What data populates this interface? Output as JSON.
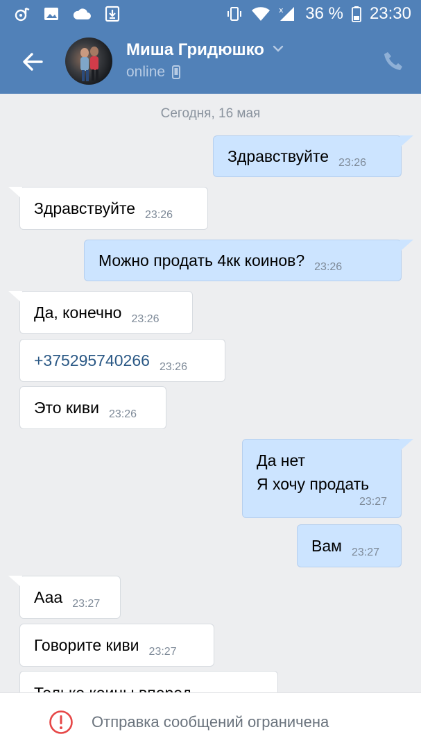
{
  "status_bar": {
    "battery_percent": "36 %",
    "time": "23:30",
    "icons": [
      "music-icon",
      "image-icon",
      "cloud-icon",
      "download-icon",
      "vibrate-icon",
      "wifi-icon",
      "signal-icon",
      "battery-icon"
    ]
  },
  "header": {
    "contact_name": "Миша Гридюшко",
    "presence": "online",
    "icons": [
      "back-arrow-icon",
      "chevron-down-icon",
      "mobile-icon",
      "phone-icon"
    ]
  },
  "chat": {
    "date_separator": "Сегодня, 16 мая",
    "messages": [
      {
        "dir": "out",
        "text": "Здравствуйте",
        "time": "23:26"
      },
      {
        "dir": "in",
        "text": "Здравствуйте",
        "time": "23:26"
      },
      {
        "dir": "out",
        "text": "Можно продать 4кк коинов?",
        "time": "23:26"
      },
      {
        "dir": "in",
        "text": "Да, конечно",
        "time": "23:26"
      },
      {
        "dir": "in",
        "text": "+375295740266",
        "time": "23:26",
        "link": true
      },
      {
        "dir": "in",
        "text": "Это киви",
        "time": "23:26"
      },
      {
        "dir": "out",
        "lines": [
          "Да нет",
          "Я хочу продать"
        ],
        "time": "23:27"
      },
      {
        "dir": "out",
        "text": "Вам",
        "time": "23:27"
      },
      {
        "dir": "in",
        "text": "Ааа",
        "time": "23:27"
      },
      {
        "dir": "in",
        "text": "Говорите киви",
        "time": "23:27"
      },
      {
        "dir": "in",
        "text": "Только коины вперед",
        "time": ""
      }
    ]
  },
  "footer": {
    "restriction_text": "Отправка сообщений ограничена",
    "icon": "alert-circle-icon"
  },
  "colors": {
    "header_bg": "#5181b8",
    "chat_bg": "#edeef0",
    "outgoing_bubble": "#cce4ff",
    "incoming_bubble": "#ffffff",
    "link": "#2a5885",
    "alert": "#e64646"
  }
}
